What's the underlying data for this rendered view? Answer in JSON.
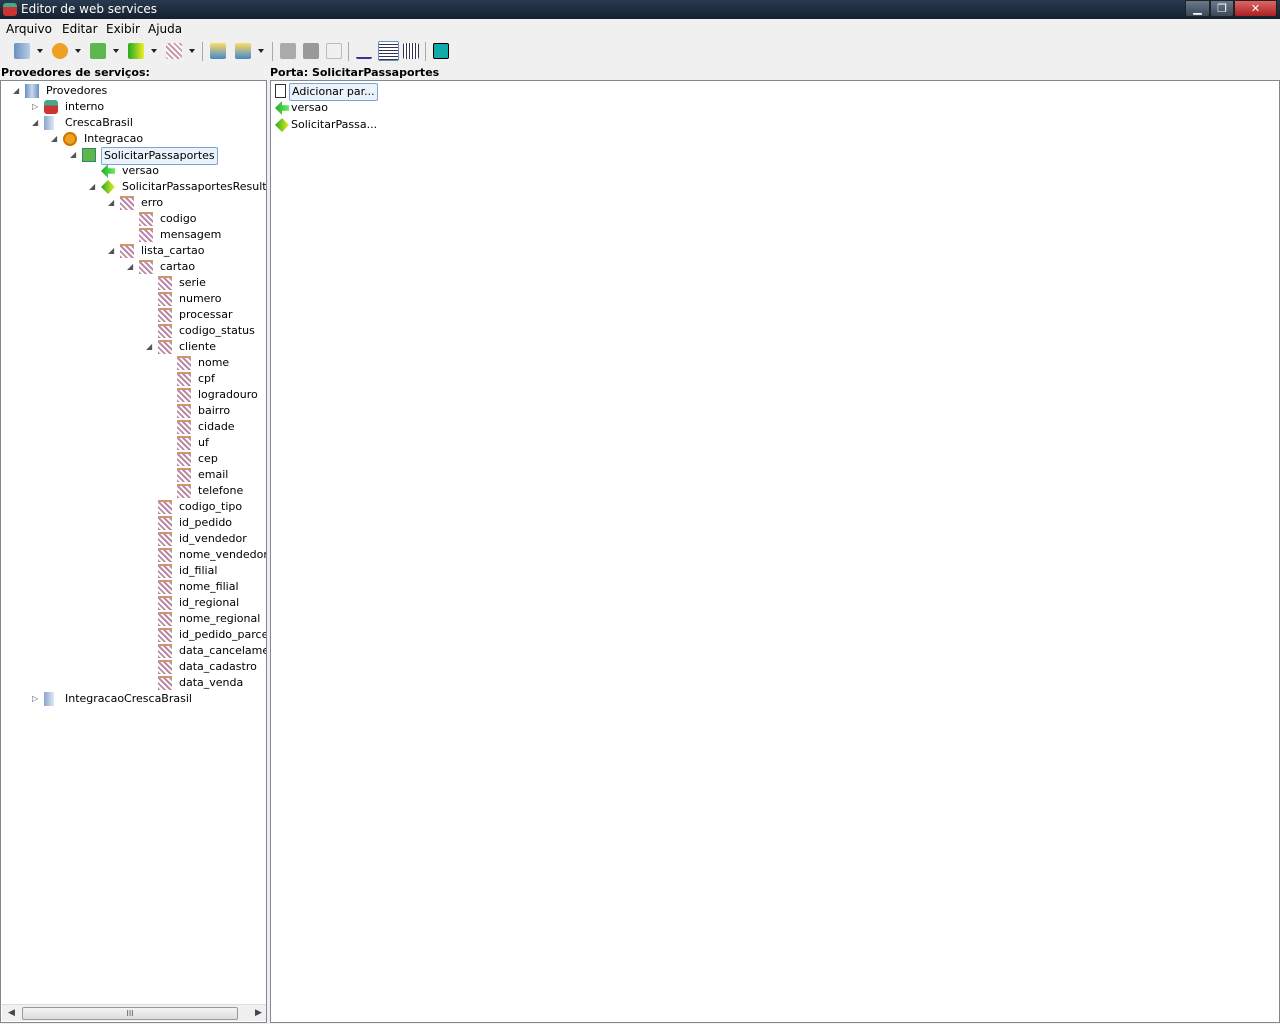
{
  "window": {
    "title": "Editor de web services",
    "minimize": "▁",
    "restore": "❐",
    "close": "✕"
  },
  "menu": [
    "Arquivo",
    "Editar",
    "Exibir",
    "Ajuda"
  ],
  "left_header": "Provedores de serviços:",
  "right_header": "Porta: SolicitarPassaportes",
  "tree": [
    {
      "label": "Provedores",
      "level": 0,
      "icon": "server",
      "toggle": "open"
    },
    {
      "label": "interno",
      "level": 1,
      "icon": "provider-red",
      "toggle": "closed"
    },
    {
      "label": "CrescaBrasil",
      "level": 1,
      "icon": "server-single",
      "toggle": "open"
    },
    {
      "label": "Integracao",
      "level": 2,
      "icon": "gear",
      "toggle": "open"
    },
    {
      "label": "SolicitarPassaportes",
      "level": 3,
      "icon": "port",
      "toggle": "open",
      "selected": true
    },
    {
      "label": "versao",
      "level": 4,
      "icon": "arrow-left",
      "toggle": ""
    },
    {
      "label": "SolicitarPassaportesResult",
      "level": 4,
      "icon": "arrow-both",
      "toggle": "open"
    },
    {
      "label": "erro",
      "level": 5,
      "icon": "field",
      "toggle": "open"
    },
    {
      "label": "codigo",
      "level": 6,
      "icon": "field",
      "toggle": ""
    },
    {
      "label": "mensagem",
      "level": 6,
      "icon": "field",
      "toggle": ""
    },
    {
      "label": "lista_cartao",
      "level": 5,
      "icon": "field",
      "toggle": "open"
    },
    {
      "label": "cartao",
      "level": 6,
      "icon": "field",
      "toggle": "open"
    },
    {
      "label": "serie",
      "level": 7,
      "icon": "field",
      "toggle": ""
    },
    {
      "label": "numero",
      "level": 7,
      "icon": "field",
      "toggle": ""
    },
    {
      "label": "processar",
      "level": 7,
      "icon": "field",
      "toggle": ""
    },
    {
      "label": "codigo_status",
      "level": 7,
      "icon": "field",
      "toggle": ""
    },
    {
      "label": "cliente",
      "level": 7,
      "icon": "field",
      "toggle": "open"
    },
    {
      "label": "nome",
      "level": 8,
      "icon": "field",
      "toggle": ""
    },
    {
      "label": "cpf",
      "level": 8,
      "icon": "field",
      "toggle": ""
    },
    {
      "label": "logradouro",
      "level": 8,
      "icon": "field",
      "toggle": ""
    },
    {
      "label": "bairro",
      "level": 8,
      "icon": "field",
      "toggle": ""
    },
    {
      "label": "cidade",
      "level": 8,
      "icon": "field",
      "toggle": ""
    },
    {
      "label": "uf",
      "level": 8,
      "icon": "field",
      "toggle": ""
    },
    {
      "label": "cep",
      "level": 8,
      "icon": "field",
      "toggle": ""
    },
    {
      "label": "email",
      "level": 8,
      "icon": "field",
      "toggle": ""
    },
    {
      "label": "telefone",
      "level": 8,
      "icon": "field",
      "toggle": ""
    },
    {
      "label": "codigo_tipo",
      "level": 7,
      "icon": "field",
      "toggle": ""
    },
    {
      "label": "id_pedido",
      "level": 7,
      "icon": "field",
      "toggle": ""
    },
    {
      "label": "id_vendedor",
      "level": 7,
      "icon": "field",
      "toggle": ""
    },
    {
      "label": "nome_vendedor",
      "level": 7,
      "icon": "field",
      "toggle": ""
    },
    {
      "label": "id_filial",
      "level": 7,
      "icon": "field",
      "toggle": ""
    },
    {
      "label": "nome_filial",
      "level": 7,
      "icon": "field",
      "toggle": ""
    },
    {
      "label": "id_regional",
      "level": 7,
      "icon": "field",
      "toggle": ""
    },
    {
      "label": "nome_regional",
      "level": 7,
      "icon": "field",
      "toggle": ""
    },
    {
      "label": "id_pedido_parceiro",
      "level": 7,
      "icon": "field",
      "toggle": ""
    },
    {
      "label": "data_cancelamento",
      "level": 7,
      "icon": "field",
      "toggle": ""
    },
    {
      "label": "data_cadastro",
      "level": 7,
      "icon": "field",
      "toggle": ""
    },
    {
      "label": "data_venda",
      "level": 7,
      "icon": "field",
      "toggle": ""
    },
    {
      "label": "IntegracaoCrescaBrasil",
      "level": 1,
      "icon": "server-single",
      "toggle": "closed"
    }
  ],
  "right_list": [
    {
      "label": "Adicionar par...",
      "icon": "new-doc",
      "selected": true
    },
    {
      "label": "versao",
      "icon": "arrow-left"
    },
    {
      "label": "SolicitarPassa...",
      "icon": "arrow-both"
    }
  ],
  "scrollbar_grip": "III"
}
